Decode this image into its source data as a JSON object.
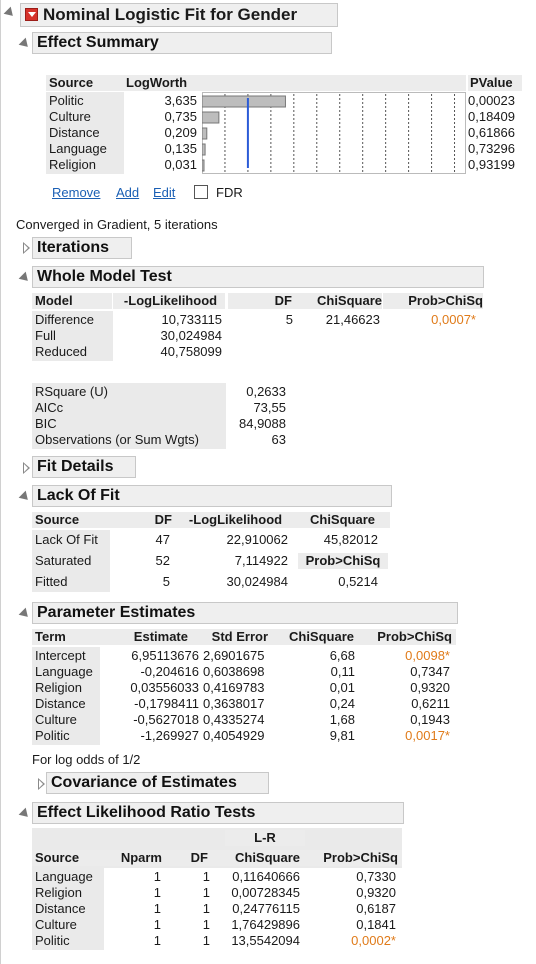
{
  "title": "Nominal Logistic Fit for Gender",
  "effect_summary": {
    "header": "Effect Summary",
    "col_source": "Source",
    "col_logworth": "LogWorth",
    "col_pvalue": "PValue",
    "rows": [
      {
        "source": "Politic",
        "logworth": "3,635",
        "pvalue": "0,00023",
        "bar_value": 3.635
      },
      {
        "source": "Culture",
        "logworth": "0,735",
        "pvalue": "0,18409",
        "bar_value": 0.735
      },
      {
        "source": "Distance",
        "logworth": "0,209",
        "pvalue": "0,61866",
        "bar_value": 0.209
      },
      {
        "source": "Language",
        "logworth": "0,135",
        "pvalue": "0,73296",
        "bar_value": 0.135
      },
      {
        "source": "Religion",
        "logworth": "0,031",
        "pvalue": "0,93199",
        "bar_value": 0.031
      }
    ],
    "bar_axis_max": 11.5,
    "reference_line_value": 2,
    "remove": "Remove",
    "add": "Add",
    "edit": "Edit",
    "fdr": "FDR"
  },
  "converged": "Converged in Gradient, 5 iterations",
  "iterations_header": "Iterations",
  "whole_model": {
    "header": "Whole Model Test",
    "cols": [
      "Model",
      "-LogLikelihood",
      "DF",
      "ChiSquare",
      "Prob>ChiSq"
    ],
    "rows": [
      {
        "model": "Difference",
        "loglik": "10,733115",
        "df": "5",
        "chisq": "21,46623",
        "prob": "0,0007*"
      },
      {
        "model": "Full",
        "loglik": "30,024984",
        "df": "",
        "chisq": "",
        "prob": ""
      },
      {
        "model": "Reduced",
        "loglik": "40,758099",
        "df": "",
        "chisq": "",
        "prob": ""
      }
    ],
    "stats": [
      {
        "label": "RSquare (U)",
        "value": "0,2633"
      },
      {
        "label": "AICc",
        "value": "73,55"
      },
      {
        "label": "BIC",
        "value": "84,9088"
      },
      {
        "label": "Observations (or Sum Wgts)",
        "value": "63"
      }
    ]
  },
  "fit_details_header": "Fit Details",
  "lack_of_fit": {
    "header": "Lack Of Fit",
    "cols": [
      "Source",
      "DF",
      "-LogLikelihood",
      "ChiSquare"
    ],
    "rows": [
      {
        "source": "Lack Of Fit",
        "df": "47",
        "loglik": "22,910062",
        "chisq": "45,82012"
      },
      {
        "source": "Saturated",
        "df": "52",
        "loglik": "7,114922",
        "chisq": "Prob>ChiSq"
      },
      {
        "source": "Fitted",
        "df": "5",
        "loglik": "30,024984",
        "chisq": "0,5214"
      }
    ]
  },
  "param_estimates": {
    "header": "Parameter Estimates",
    "cols": [
      "Term",
      "Estimate",
      "Std Error",
      "ChiSquare",
      "Prob>ChiSq"
    ],
    "rows": [
      {
        "term": "Intercept",
        "est": "6,95113676",
        "se": "2,6901675",
        "chisq": "6,68",
        "prob": "0,0098*",
        "sig": true
      },
      {
        "term": "Language",
        "est": "-0,204616",
        "se": "0,6038698",
        "chisq": "0,11",
        "prob": "0,7347",
        "sig": false
      },
      {
        "term": "Religion",
        "est": "0,03556033",
        "se": "0,4169783",
        "chisq": "0,01",
        "prob": "0,9320",
        "sig": false
      },
      {
        "term": "Distance",
        "est": "-0,1798411",
        "se": "0,3638017",
        "chisq": "0,24",
        "prob": "0,6211",
        "sig": false
      },
      {
        "term": "Culture",
        "est": "-0,5627018",
        "se": "0,4335274",
        "chisq": "1,68",
        "prob": "0,1943",
        "sig": false
      },
      {
        "term": "Politic",
        "est": "-1,269927",
        "se": "0,4054929",
        "chisq": "9,81",
        "prob": "0,0017*",
        "sig": true
      }
    ],
    "note": "For log odds of 1/2"
  },
  "covariance_header": "Covariance of Estimates",
  "effect_lr": {
    "header": "Effect Likelihood Ratio Tests",
    "lr_label": "L-R",
    "cols": [
      "Source",
      "Nparm",
      "DF",
      "ChiSquare",
      "Prob>ChiSq"
    ],
    "rows": [
      {
        "source": "Language",
        "nparm": "1",
        "df": "1",
        "chisq": "0,11640666",
        "prob": "0,7330",
        "sig": false
      },
      {
        "source": "Religion",
        "nparm": "1",
        "df": "1",
        "chisq": "0,00728345",
        "prob": "0,9320",
        "sig": false
      },
      {
        "source": "Distance",
        "nparm": "1",
        "df": "1",
        "chisq": "0,24776115",
        "prob": "0,6187",
        "sig": false
      },
      {
        "source": "Culture",
        "nparm": "1",
        "df": "1",
        "chisq": "1,76429896",
        "prob": "0,1841",
        "sig": false
      },
      {
        "source": "Politic",
        "nparm": "1",
        "df": "1",
        "chisq": "13,5542094",
        "prob": "0,0002*",
        "sig": true
      }
    ]
  },
  "colors": {
    "significant": "#e07b1a",
    "link": "#1a5fb4",
    "bar": "#bdbdbd",
    "refline": "#2b5bd7",
    "header_bg": "#efefef"
  }
}
